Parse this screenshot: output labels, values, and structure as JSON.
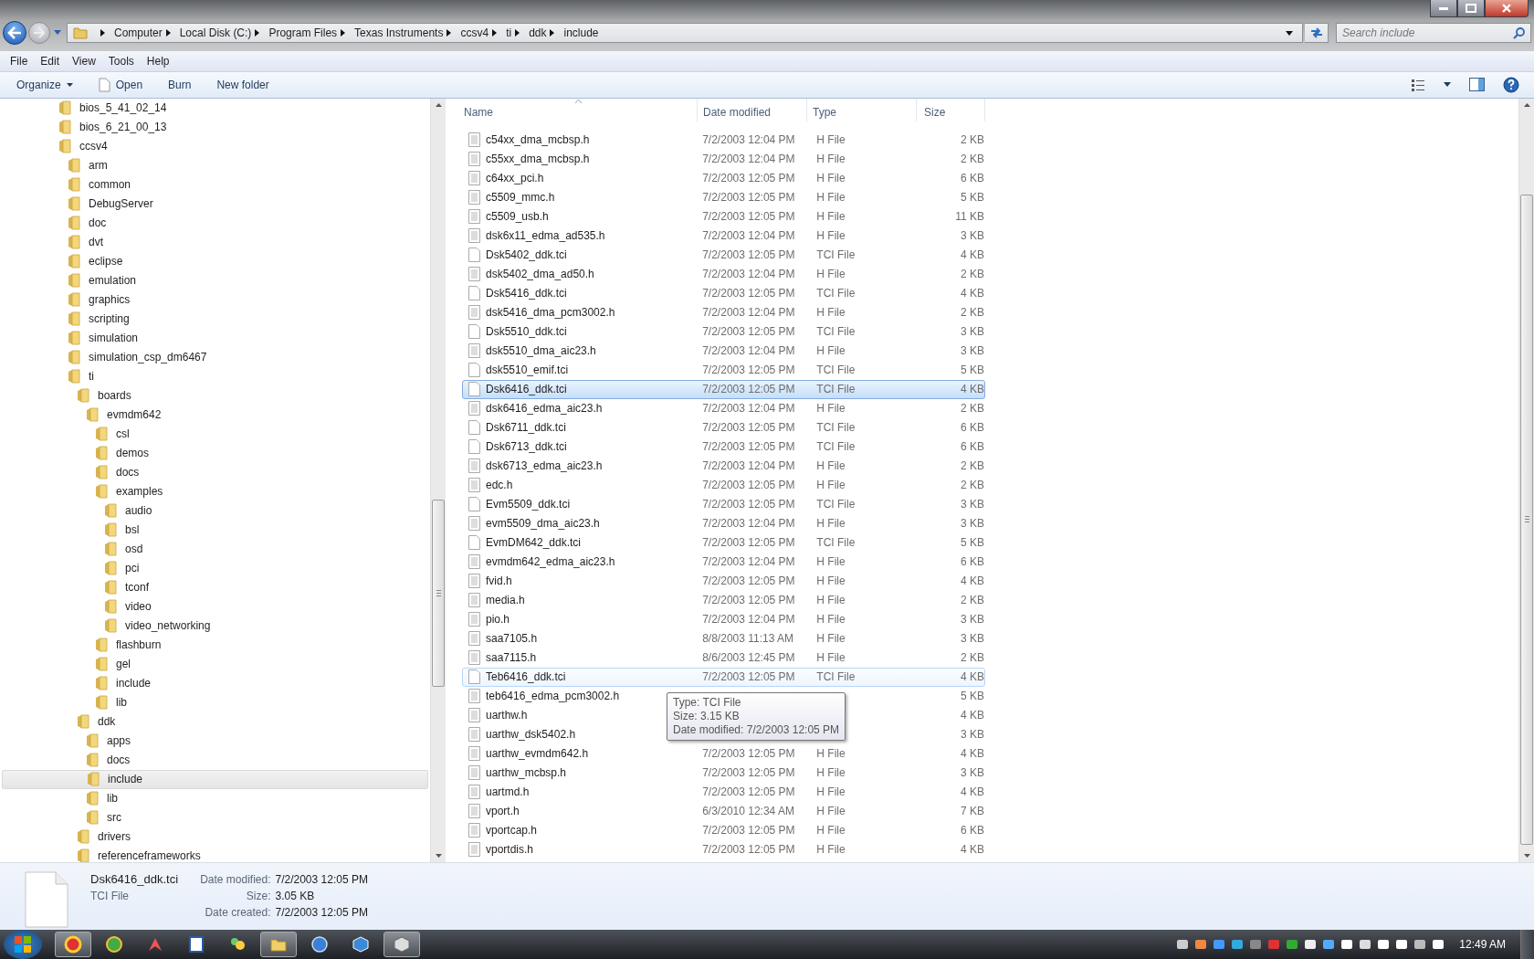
{
  "address_bar": {
    "breadcrumb": [
      "Computer",
      "Local Disk (C:)",
      "Program Files",
      "Texas Instruments",
      "ccsv4",
      "ti",
      "ddk",
      "include"
    ]
  },
  "search": {
    "placeholder": "Search include"
  },
  "menu_bar": [
    "File",
    "Edit",
    "View",
    "Tools",
    "Help"
  ],
  "toolbar": [
    {
      "label": "Organize",
      "kind": "dropdown"
    },
    {
      "label": "Open",
      "kind": "file"
    },
    {
      "label": "Burn",
      "kind": "plain"
    },
    {
      "label": "New folder",
      "kind": "plain"
    }
  ],
  "tree": [
    {
      "label": "bios_5_41_02_14",
      "selected": false
    },
    {
      "label": "bios_6_21_00_13",
      "selected": false
    },
    {
      "label": "ccsv4",
      "selected": false,
      "children": [
        {
          "label": "arm",
          "selected": false
        },
        {
          "label": "common",
          "selected": false
        },
        {
          "label": "DebugServer",
          "selected": false
        },
        {
          "label": "doc",
          "selected": false
        },
        {
          "label": "dvt",
          "selected": false
        },
        {
          "label": "eclipse",
          "selected": false
        },
        {
          "label": "emulation",
          "selected": false
        },
        {
          "label": "graphics",
          "selected": false
        },
        {
          "label": "scripting",
          "selected": false
        },
        {
          "label": "simulation",
          "selected": false
        },
        {
          "label": "simulation_csp_dm6467",
          "selected": false
        },
        {
          "label": "ti",
          "selected": false,
          "children": [
            {
              "label": "boards",
              "selected": false,
              "children": [
                {
                  "label": "evmdm642",
                  "selected": false,
                  "children": [
                    {
                      "label": "csl",
                      "selected": false
                    },
                    {
                      "label": "demos",
                      "selected": false
                    },
                    {
                      "label": "docs",
                      "selected": false
                    },
                    {
                      "label": "examples",
                      "selected": false,
                      "children": [
                        {
                          "label": "audio",
                          "selected": false
                        },
                        {
                          "label": "bsl",
                          "selected": false
                        },
                        {
                          "label": "osd",
                          "selected": false
                        },
                        {
                          "label": "pci",
                          "selected": false
                        },
                        {
                          "label": "tconf",
                          "selected": false
                        },
                        {
                          "label": "video",
                          "selected": false
                        },
                        {
                          "label": "video_networking",
                          "selected": false
                        }
                      ]
                    },
                    {
                      "label": "flashburn",
                      "selected": false
                    },
                    {
                      "label": "gel",
                      "selected": false
                    },
                    {
                      "label": "include",
                      "selected": false
                    },
                    {
                      "label": "lib",
                      "selected": false
                    }
                  ]
                }
              ]
            },
            {
              "label": "ddk",
              "selected": false,
              "children": [
                {
                  "label": "apps",
                  "selected": false
                },
                {
                  "label": "docs",
                  "selected": false
                },
                {
                  "label": "include",
                  "selected": true
                },
                {
                  "label": "lib",
                  "selected": false
                },
                {
                  "label": "src",
                  "selected": false
                }
              ]
            },
            {
              "label": "drivers",
              "selected": false
            },
            {
              "label": "referenceframeworks",
              "selected": false
            }
          ]
        }
      ]
    }
  ],
  "file_list": {
    "columns": [
      "Name",
      "Date modified",
      "Type",
      "Size"
    ],
    "rows": [
      {
        "name": "c54xx_dma_mcbsp.h",
        "date": "7/2/2003 12:04 PM",
        "type": "H File",
        "size": "2 KB",
        "kind": "text",
        "selected": false,
        "hovered": false
      },
      {
        "name": "c55xx_dma_mcbsp.h",
        "date": "7/2/2003 12:04 PM",
        "type": "H File",
        "size": "2 KB",
        "kind": "text",
        "selected": false,
        "hovered": false
      },
      {
        "name": "c64xx_pci.h",
        "date": "7/2/2003 12:05 PM",
        "type": "H File",
        "size": "6 KB",
        "kind": "text",
        "selected": false,
        "hovered": false
      },
      {
        "name": "c5509_mmc.h",
        "date": "7/2/2003 12:05 PM",
        "type": "H File",
        "size": "5 KB",
        "kind": "text",
        "selected": false,
        "hovered": false
      },
      {
        "name": "c5509_usb.h",
        "date": "7/2/2003 12:05 PM",
        "type": "H File",
        "size": "11 KB",
        "kind": "text",
        "selected": false,
        "hovered": false
      },
      {
        "name": "dsk6x11_edma_ad535.h",
        "date": "7/2/2003 12:04 PM",
        "type": "H File",
        "size": "3 KB",
        "kind": "text",
        "selected": false,
        "hovered": false
      },
      {
        "name": "Dsk5402_ddk.tci",
        "date": "7/2/2003 12:05 PM",
        "type": "TCI File",
        "size": "4 KB",
        "kind": "blank",
        "selected": false,
        "hovered": false
      },
      {
        "name": "dsk5402_dma_ad50.h",
        "date": "7/2/2003 12:04 PM",
        "type": "H File",
        "size": "2 KB",
        "kind": "text",
        "selected": false,
        "hovered": false
      },
      {
        "name": "Dsk5416_ddk.tci",
        "date": "7/2/2003 12:05 PM",
        "type": "TCI File",
        "size": "4 KB",
        "kind": "blank",
        "selected": false,
        "hovered": false
      },
      {
        "name": "dsk5416_dma_pcm3002.h",
        "date": "7/2/2003 12:04 PM",
        "type": "H File",
        "size": "2 KB",
        "kind": "text",
        "selected": false,
        "hovered": false
      },
      {
        "name": "Dsk5510_ddk.tci",
        "date": "7/2/2003 12:05 PM",
        "type": "TCI File",
        "size": "3 KB",
        "kind": "blank",
        "selected": false,
        "hovered": false
      },
      {
        "name": "dsk5510_dma_aic23.h",
        "date": "7/2/2003 12:04 PM",
        "type": "H File",
        "size": "3 KB",
        "kind": "text",
        "selected": false,
        "hovered": false
      },
      {
        "name": "dsk5510_emif.tci",
        "date": "7/2/2003 12:05 PM",
        "type": "TCI File",
        "size": "5 KB",
        "kind": "blank",
        "selected": false,
        "hovered": false
      },
      {
        "name": "Dsk6416_ddk.tci",
        "date": "7/2/2003 12:05 PM",
        "type": "TCI File",
        "size": "4 KB",
        "kind": "blank",
        "selected": true,
        "hovered": false
      },
      {
        "name": "dsk6416_edma_aic23.h",
        "date": "7/2/2003 12:04 PM",
        "type": "H File",
        "size": "2 KB",
        "kind": "text",
        "selected": false,
        "hovered": false
      },
      {
        "name": "Dsk6711_ddk.tci",
        "date": "7/2/2003 12:05 PM",
        "type": "TCI File",
        "size": "6 KB",
        "kind": "blank",
        "selected": false,
        "hovered": false
      },
      {
        "name": "Dsk6713_ddk.tci",
        "date": "7/2/2003 12:05 PM",
        "type": "TCI File",
        "size": "6 KB",
        "kind": "blank",
        "selected": false,
        "hovered": false
      },
      {
        "name": "dsk6713_edma_aic23.h",
        "date": "7/2/2003 12:04 PM",
        "type": "H File",
        "size": "2 KB",
        "kind": "text",
        "selected": false,
        "hovered": false
      },
      {
        "name": "edc.h",
        "date": "7/2/2003 12:05 PM",
        "type": "H File",
        "size": "2 KB",
        "kind": "text",
        "selected": false,
        "hovered": false
      },
      {
        "name": "Evm5509_ddk.tci",
        "date": "7/2/2003 12:05 PM",
        "type": "TCI File",
        "size": "3 KB",
        "kind": "blank",
        "selected": false,
        "hovered": false
      },
      {
        "name": "evm5509_dma_aic23.h",
        "date": "7/2/2003 12:04 PM",
        "type": "H File",
        "size": "3 KB",
        "kind": "text",
        "selected": false,
        "hovered": false
      },
      {
        "name": "EvmDM642_ddk.tci",
        "date": "7/2/2003 12:05 PM",
        "type": "TCI File",
        "size": "5 KB",
        "kind": "blank",
        "selected": false,
        "hovered": false
      },
      {
        "name": "evmdm642_edma_aic23.h",
        "date": "7/2/2003 12:04 PM",
        "type": "H File",
        "size": "6 KB",
        "kind": "text",
        "selected": false,
        "hovered": false
      },
      {
        "name": "fvid.h",
        "date": "7/2/2003 12:05 PM",
        "type": "H File",
        "size": "4 KB",
        "kind": "text",
        "selected": false,
        "hovered": false
      },
      {
        "name": "media.h",
        "date": "7/2/2003 12:05 PM",
        "type": "H File",
        "size": "2 KB",
        "kind": "text",
        "selected": false,
        "hovered": false
      },
      {
        "name": "pio.h",
        "date": "7/2/2003 12:04 PM",
        "type": "H File",
        "size": "3 KB",
        "kind": "text",
        "selected": false,
        "hovered": false
      },
      {
        "name": "saa7105.h",
        "date": "8/8/2003 11:13 AM",
        "type": "H File",
        "size": "3 KB",
        "kind": "text",
        "selected": false,
        "hovered": false
      },
      {
        "name": "saa7115.h",
        "date": "8/6/2003 12:45 PM",
        "type": "H File",
        "size": "2 KB",
        "kind": "text",
        "selected": false,
        "hovered": false
      },
      {
        "name": "Teb6416_ddk.tci",
        "date": "7/2/2003 12:05 PM",
        "type": "TCI File",
        "size": "4 KB",
        "kind": "blank",
        "selected": false,
        "hovered": true
      },
      {
        "name": "teb6416_edma_pcm3002.h",
        "size": "5 KB",
        "kind": "text",
        "selected": false,
        "hovered": false
      },
      {
        "name": "uarthw.h",
        "size": "4 KB",
        "kind": "text",
        "selected": false,
        "hovered": false
      },
      {
        "name": "uarthw_dsk5402.h",
        "size": "3 KB",
        "kind": "text",
        "selected": false,
        "hovered": false
      },
      {
        "name": "uarthw_evmdm642.h",
        "date": "7/2/2003 12:05 PM",
        "type": "H File",
        "size": "4 KB",
        "kind": "text",
        "selected": false,
        "hovered": false
      },
      {
        "name": "uarthw_mcbsp.h",
        "date": "7/2/2003 12:05 PM",
        "type": "H File",
        "size": "3 KB",
        "kind": "text",
        "selected": false,
        "hovered": false
      },
      {
        "name": "uartmd.h",
        "date": "7/2/2003 12:05 PM",
        "type": "H File",
        "size": "4 KB",
        "kind": "text",
        "selected": false,
        "hovered": false
      },
      {
        "name": "vport.h",
        "date": "6/3/2010 12:34 AM",
        "type": "H File",
        "size": "7 KB",
        "kind": "text",
        "selected": false,
        "hovered": false
      },
      {
        "name": "vportcap.h",
        "date": "7/2/2003 12:05 PM",
        "type": "H File",
        "size": "6 KB",
        "kind": "text",
        "selected": false,
        "hovered": false
      },
      {
        "name": "vportdis.h",
        "date": "7/2/2003 12:05 PM",
        "type": "H File",
        "size": "4 KB",
        "kind": "text",
        "selected": false,
        "hovered": false
      }
    ]
  },
  "tooltip": {
    "lines": [
      "Type: TCI File",
      "Size: 3.15 KB",
      "Date modified: 7/2/2003 12:05 PM"
    ]
  },
  "details": {
    "name": "Dsk6416_ddk.tci",
    "type": "TCI File",
    "fields": [
      {
        "label": "Date modified:",
        "value": "7/2/2003 12:05 PM"
      },
      {
        "label": "Size:",
        "value": "3.05 KB"
      },
      {
        "label": "Date created:",
        "value": "7/2/2003 12:05 PM"
      }
    ]
  },
  "taskbar": {
    "clock": "12:49 AM"
  }
}
